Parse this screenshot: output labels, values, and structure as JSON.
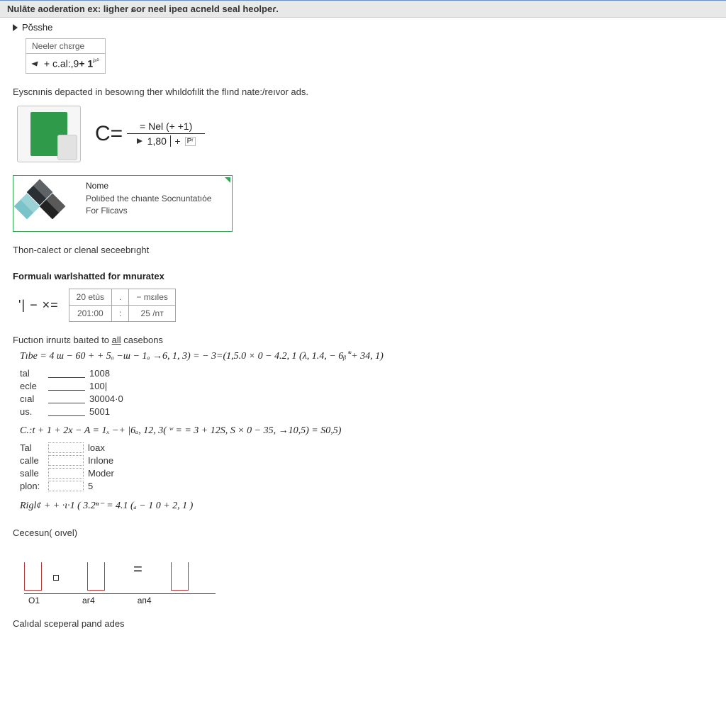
{
  "header": {
    "title": "Nulāte aoderation ex: ligher ɕor neel ipeɑ acneld seal heolpeɾ."
  },
  "expand": {
    "label": "Pŏsshe",
    "small_table": {
      "header": "Neeler chɛrge",
      "expr_prefix": " + c.al:,9",
      "expr_bold": "+ 1",
      "expr_super": "iˢ⁰"
    }
  },
  "intro1": "Eyscnınis depacted in besowıng ther whıldofılit the flınd nate:/reıvor ads.",
  "frac": {
    "left": "C=",
    "top": "= Nel (+ +1)",
    "bot_prefix": " 1,80",
    "bot_plus": " + ",
    "bot_super": "Pʳ"
  },
  "card": {
    "title": "Nome",
    "line1": "Polıḃed the chıante Socnuntatıȯe",
    "line2": "For Flicavs"
  },
  "heading1": "Thon-calect or clenal seceebrıght",
  "heading2": "Formualı warlshatted for mnuratex",
  "ix": {
    "left": "'| − ×=",
    "table": [
      [
        "20 etùs",
        ".",
        "− mɛıles"
      ],
      [
        "201:00",
        ":",
        "25 /nт"
      ]
    ]
  },
  "heading3_pre": "Fuctıon irnuıtɛ baıted to ",
  "heading3_link": "all",
  "heading3_post": " casebons",
  "eq1": "Tıbe   =  4 ɯ − 60 + +  5ₐ −ɯ − 1ₐ →6, 1, 3) = − 3=(1,5.0 × 0 − 4.2,  1 (λ, 1.4, − 6ᵦ ͌ + 34, 1)",
  "list1": [
    {
      "lbl": "tal",
      "val": "1008"
    },
    {
      "lbl": "ecle",
      "val": "100|"
    },
    {
      "lbl": "cıal",
      "val": "30004·0"
    },
    {
      "lbl": "us.",
      "val": "5001"
    }
  ],
  "eq2": "C.:t    + 1 + 2x − A  =  1ₓ −+ |6ₐ, 12, 3( ʷ = = 3 + 12S, S × 0 − 35, →10,5)  = S0,5)",
  "list2": [
    {
      "lbl": "Tal",
      "val": "loax"
    },
    {
      "lbl": "calle",
      "val": "Irılone"
    },
    {
      "lbl": "salle",
      "val": "Moder"
    },
    {
      "lbl": "plon:",
      "val": "5"
    }
  ],
  "eq3": "Rigl¢  +  + ·ι·1 ( 3.2ⁿ⁻ = 4.1 (ₐ − 1 0  + 2, 1 )",
  "heading4": "Cecesun( oıvel)",
  "diagram": {
    "equals": "=",
    "labels": [
      "O1",
      "aг4",
      "aп4"
    ]
  },
  "heading5": "Calıdal sceperal pand ades"
}
